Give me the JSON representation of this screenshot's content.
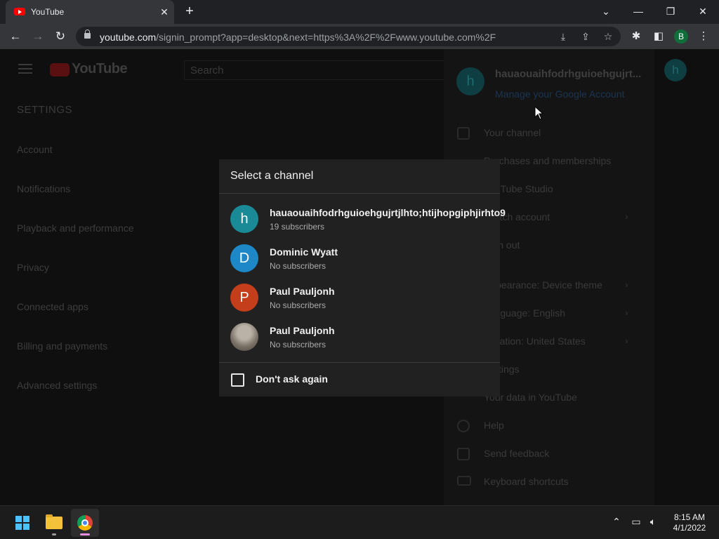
{
  "browser": {
    "tab_title": "YouTube",
    "tab_close": "✕",
    "new_tab": "+",
    "minimize": "—",
    "restore": "❐",
    "close": "✕",
    "url_host": "youtube.com",
    "url_path": "/signin_prompt?app=desktop&next=https%3A%2F%2Fwww.youtube.com%2F",
    "profile_initial": "B"
  },
  "youtube": {
    "logo_text": "YouTube",
    "search_placeholder": "Search",
    "settings_title": "SETTINGS",
    "settings_items": [
      "Account",
      "Notifications",
      "Playback and performance",
      "Privacy",
      "Connected apps",
      "Billing and payments",
      "Advanced settings"
    ],
    "top_avatar_initial": "h"
  },
  "account_menu": {
    "avatar_initial": "h",
    "name": "hauaouaihfodrhguioehgujrt...",
    "manage": "Manage your Google Account",
    "items": [
      "Your channel",
      "Purchases and memberships",
      "YouTube Studio",
      "Switch account",
      "Sign out",
      "Appearance: Device theme",
      "Language: English",
      "Location: United States",
      "Settings",
      "Your data in YouTube",
      "Help",
      "Send feedback",
      "Keyboard shortcuts"
    ]
  },
  "dialog": {
    "title": "Select a channel",
    "channels": [
      {
        "initial": "h",
        "name": "hauaouaihfodrhguioehgujrtjlhto;htijhopgiphjirhto9",
        "subscribers": "19 subscribers",
        "color": "#1a8a96"
      },
      {
        "initial": "D",
        "name": "Dominic Wyatt",
        "subscribers": "No subscribers",
        "color": "#1e88c7"
      },
      {
        "initial": "P",
        "name": "Paul Pauljonh",
        "subscribers": "No subscribers",
        "color": "#c43e1c"
      },
      {
        "initial": "",
        "name": "Paul Pauljonh",
        "subscribers": "No subscribers",
        "color": "#7a7166"
      }
    ],
    "dont_ask_label": "Don't ask again"
  },
  "taskbar": {
    "time": "8:15 AM",
    "date": "4/1/2022",
    "chrome_indicator_color": "#e48ee0"
  }
}
